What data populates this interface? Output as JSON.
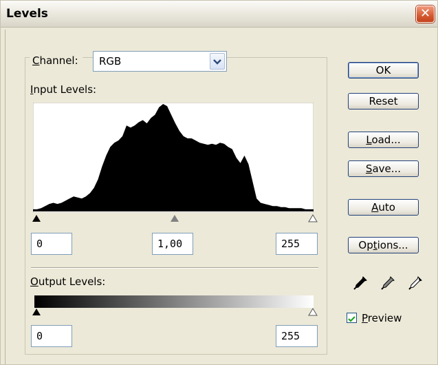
{
  "window": {
    "title": "Levels",
    "close_glyph": "✕"
  },
  "channel": {
    "label_prefix": "",
    "label_accel": "C",
    "label_rest": "hannel:",
    "value": "RGB"
  },
  "input_levels": {
    "label_accel": "I",
    "label_rest": "nput Levels:",
    "black": "0",
    "gamma": "1,00",
    "white": "255"
  },
  "output_levels": {
    "label_accel": "O",
    "label_rest": "utput Levels:",
    "black": "0",
    "white": "255"
  },
  "buttons": {
    "ok": "OK",
    "reset": "Reset",
    "load_accel": "L",
    "load_rest": "oad...",
    "save_accel": "S",
    "save_rest": "ave...",
    "auto_accel": "A",
    "auto_rest": "uto",
    "options_pre": "Op",
    "options_accel": "t",
    "options_rest": "ions..."
  },
  "preview": {
    "checked": true,
    "label_accel": "P",
    "label_rest": "review"
  },
  "icons": {
    "close": "close-icon",
    "dropdown": "chevron-down-icon",
    "eyedroppers": [
      "black-eyedropper-icon",
      "gray-eyedropper-icon",
      "white-eyedropper-icon"
    ],
    "check": "check-icon"
  },
  "histogram": {
    "color": "#000000",
    "values": [
      0.02,
      0.02,
      0.03,
      0.05,
      0.07,
      0.08,
      0.07,
      0.08,
      0.1,
      0.12,
      0.14,
      0.13,
      0.12,
      0.14,
      0.17,
      0.22,
      0.3,
      0.42,
      0.52,
      0.6,
      0.64,
      0.66,
      0.7,
      0.8,
      0.78,
      0.8,
      0.83,
      0.85,
      0.82,
      0.87,
      0.9,
      0.97,
      1.0,
      0.98,
      0.9,
      0.82,
      0.75,
      0.7,
      0.68,
      0.68,
      0.66,
      0.64,
      0.63,
      0.62,
      0.63,
      0.62,
      0.64,
      0.63,
      0.6,
      0.58,
      0.5,
      0.45,
      0.52,
      0.44,
      0.28,
      0.12,
      0.08,
      0.07,
      0.06,
      0.05,
      0.05,
      0.04,
      0.04,
      0.03,
      0.03,
      0.03,
      0.03,
      0.02,
      0.02,
      0.02
    ]
  }
}
